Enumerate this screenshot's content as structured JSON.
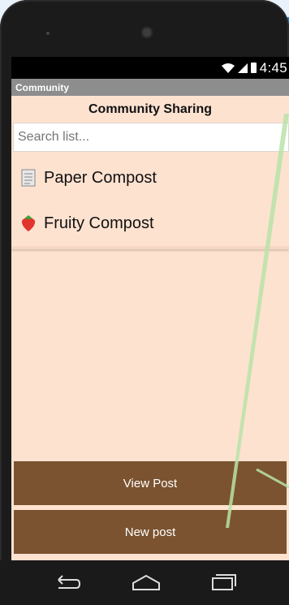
{
  "status_bar": {
    "time": "4:45"
  },
  "app": {
    "title": "Community"
  },
  "header": {
    "title": "Community Sharing"
  },
  "search": {
    "placeholder": "Search list..."
  },
  "list": {
    "items": [
      {
        "label": "Paper Compost",
        "icon": "paper-icon"
      },
      {
        "label": "Fruity Compost",
        "icon": "strawberry-icon"
      }
    ]
  },
  "buttons": {
    "view_post": "View Post",
    "new_post": "New post"
  },
  "colors": {
    "screen_bg": "#fde2d0",
    "button_bg": "#7b5330",
    "title_bar": "#8d8d8d"
  }
}
